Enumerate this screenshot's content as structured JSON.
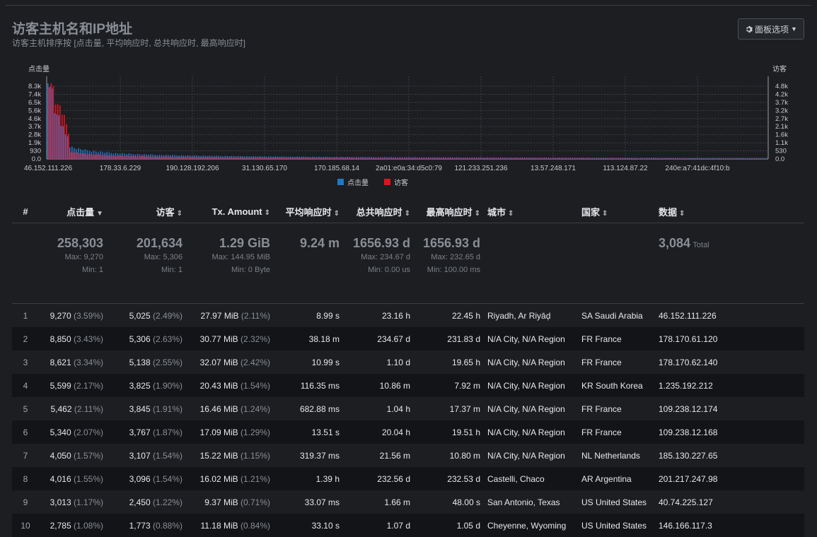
{
  "panel": {
    "title": "访客主机名和IP地址",
    "subtitle": "访客主机排序按 [点击量, 平均响应时, 总共响应时, 最高响应时]",
    "options_label": "面板选项",
    "options_icon": "gear-icon"
  },
  "chart_data": {
    "type": "bar",
    "left_axis_label": "点击量",
    "right_axis_label": "访客",
    "left_ticks": [
      "8.3k",
      "7.4k",
      "6.5k",
      "5.6k",
      "4.6k",
      "3.7k",
      "2.8k",
      "1.9k",
      "930",
      "0.0"
    ],
    "right_ticks": [
      "4.8k",
      "4.2k",
      "3.7k",
      "3.2k",
      "2.7k",
      "2.1k",
      "1.6k",
      "1.1k",
      "530",
      "0.0"
    ],
    "x_labels": [
      "46.152.111.226",
      "178.33.6.229",
      "190.128.192.206",
      "31.130.65.170",
      "170.185.68.14",
      "2a01:e0a:34:d5c0:79",
      "121.233.251.236",
      "13.57.248.171",
      "113.124.87.22",
      "240e:a7:41dc:4f10:b"
    ],
    "series": [
      {
        "name": "点击量",
        "color": "#1f78c8"
      },
      {
        "name": "访客",
        "color": "#e0121f"
      }
    ],
    "ylim_left": [
      0,
      9270
    ],
    "ylim_right": [
      0,
      5306
    ],
    "top_hits": [
      9270,
      8850,
      8621,
      5599,
      5462,
      5340,
      4050,
      4016,
      3013,
      2785
    ],
    "top_visitors": [
      5025,
      5306,
      5138,
      3825,
      3845,
      3767,
      3107,
      3096,
      2450,
      1773
    ]
  },
  "table": {
    "headers": [
      "#",
      "点击量",
      "访客",
      "Tx. Amount",
      "平均响应时",
      "总共响应时",
      "最高响应时",
      "城市",
      "国家",
      "数据"
    ],
    "summary": {
      "hits": {
        "total": "258,303",
        "max": "Max: 9,270",
        "min": "Min: 1"
      },
      "visitors": {
        "total": "201,634",
        "max": "Max: 5,306",
        "min": "Min: 1"
      },
      "tx": {
        "total": "1.29 GiB",
        "max": "Max: 144.95 MiB",
        "min": "Min: 0 Byte"
      },
      "avg": {
        "total": "9.24 m"
      },
      "cum": {
        "total": "1656.93 d",
        "max": "Max: 234.67 d",
        "min": "Min: 0.00 us"
      },
      "maxt": {
        "total": "1656.93 d",
        "max": "Max: 232.65 d",
        "min": "Min: 100.00 ms"
      },
      "data": {
        "total": "3,084",
        "label": "Total"
      }
    },
    "rows": [
      {
        "n": "1",
        "hits": "9,270",
        "hits_pct": "(3.59%)",
        "vis": "5,025",
        "vis_pct": "(2.49%)",
        "tx": "27.97 MiB",
        "tx_pct": "(2.11%)",
        "avg": "8.99 s",
        "cum": "23.16 h",
        "max": "22.45 h",
        "city": "Riyadh, Ar Riyāḑ",
        "country": "SA Saudi Arabia",
        "data": "46.152.111.226"
      },
      {
        "n": "2",
        "hits": "8,850",
        "hits_pct": "(3.43%)",
        "vis": "5,306",
        "vis_pct": "(2.63%)",
        "tx": "30.77 MiB",
        "tx_pct": "(2.32%)",
        "avg": "38.18 m",
        "cum": "234.67 d",
        "max": "231.83 d",
        "city": "N/A City, N/A Region",
        "country": "FR France",
        "data": "178.170.61.120"
      },
      {
        "n": "3",
        "hits": "8,621",
        "hits_pct": "(3.34%)",
        "vis": "5,138",
        "vis_pct": "(2.55%)",
        "tx": "32.07 MiB",
        "tx_pct": "(2.42%)",
        "avg": "10.99 s",
        "cum": "1.10 d",
        "max": "19.65 h",
        "city": "N/A City, N/A Region",
        "country": "FR France",
        "data": "178.170.62.140"
      },
      {
        "n": "4",
        "hits": "5,599",
        "hits_pct": "(2.17%)",
        "vis": "3,825",
        "vis_pct": "(1.90%)",
        "tx": "20.43 MiB",
        "tx_pct": "(1.54%)",
        "avg": "116.35 ms",
        "cum": "10.86 m",
        "max": "7.92 m",
        "city": "N/A City, N/A Region",
        "country": "KR South Korea",
        "data": "1.235.192.212"
      },
      {
        "n": "5",
        "hits": "5,462",
        "hits_pct": "(2.11%)",
        "vis": "3,845",
        "vis_pct": "(1.91%)",
        "tx": "16.46 MiB",
        "tx_pct": "(1.24%)",
        "avg": "682.88 ms",
        "cum": "1.04 h",
        "max": "17.37 m",
        "city": "N/A City, N/A Region",
        "country": "FR France",
        "data": "109.238.12.174"
      },
      {
        "n": "6",
        "hits": "5,340",
        "hits_pct": "(2.07%)",
        "vis": "3,767",
        "vis_pct": "(1.87%)",
        "tx": "17.09 MiB",
        "tx_pct": "(1.29%)",
        "avg": "13.51 s",
        "cum": "20.04 h",
        "max": "19.51 h",
        "city": "N/A City, N/A Region",
        "country": "FR France",
        "data": "109.238.12.168"
      },
      {
        "n": "7",
        "hits": "4,050",
        "hits_pct": "(1.57%)",
        "vis": "3,107",
        "vis_pct": "(1.54%)",
        "tx": "15.22 MiB",
        "tx_pct": "(1.15%)",
        "avg": "319.37 ms",
        "cum": "21.56 m",
        "max": "10.80 m",
        "city": "N/A City, N/A Region",
        "country": "NL Netherlands",
        "data": "185.130.227.65"
      },
      {
        "n": "8",
        "hits": "4,016",
        "hits_pct": "(1.55%)",
        "vis": "3,096",
        "vis_pct": "(1.54%)",
        "tx": "16.02 MiB",
        "tx_pct": "(1.21%)",
        "avg": "1.39 h",
        "cum": "232.56 d",
        "max": "232.53 d",
        "city": "Castelli, Chaco",
        "country": "AR Argentina",
        "data": "201.217.247.98"
      },
      {
        "n": "9",
        "hits": "3,013",
        "hits_pct": "(1.17%)",
        "vis": "2,450",
        "vis_pct": "(1.22%)",
        "tx": "9.37 MiB",
        "tx_pct": "(0.71%)",
        "avg": "33.07 ms",
        "cum": "1.66 m",
        "max": "48.00 s",
        "city": "San Antonio, Texas",
        "country": "US United States",
        "data": "40.74.225.127"
      },
      {
        "n": "10",
        "hits": "2,785",
        "hits_pct": "(1.08%)",
        "vis": "1,773",
        "vis_pct": "(0.88%)",
        "tx": "11.18 MiB",
        "tx_pct": "(0.84%)",
        "avg": "33.10 s",
        "cum": "1.07 d",
        "max": "1.05 d",
        "city": "Cheyenne, Wyoming",
        "country": "US United States",
        "data": "146.166.117.3"
      }
    ]
  }
}
